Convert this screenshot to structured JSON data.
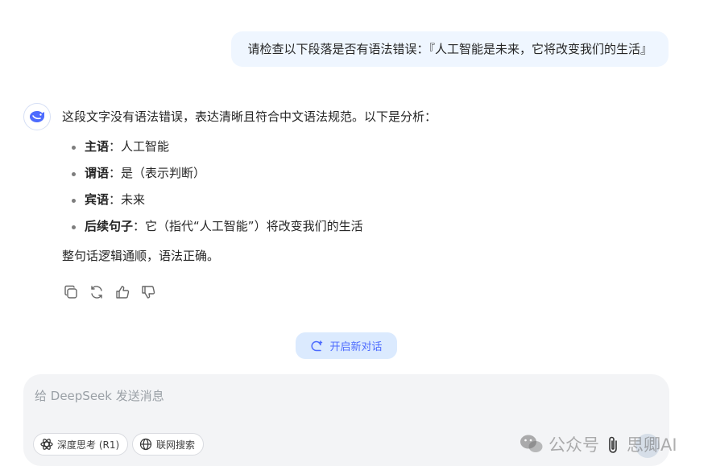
{
  "user_message": "请检查以下段落是否有语法错误：『人工智能是未来，它将改变我们的生活』",
  "assistant": {
    "intro": "这段文字没有语法错误，表达清晰且符合中文语法规范。以下是分析：",
    "items": [
      {
        "label": "主语",
        "sep": "：",
        "text": "人工智能"
      },
      {
        "label": "谓语",
        "sep": "：",
        "text": "是（表示判断）"
      },
      {
        "label": "宾语",
        "sep": "：",
        "text": "未来"
      },
      {
        "label": "后续句子",
        "sep": "：",
        "text": "它（指代“人工智能”）将改变我们的生活"
      }
    ],
    "summary": "整句话逻辑通顺，语法正确。",
    "actions": [
      "copy-icon",
      "regenerate-icon",
      "thumbs-up-icon",
      "thumbs-down-icon"
    ]
  },
  "new_chat": {
    "label": "开启新对话",
    "icon": "new-chat-icon"
  },
  "composer": {
    "placeholder": "给 DeepSeek 发送消息",
    "deep_think_label": "深度思考 (R1)",
    "web_search_label": "联网搜索"
  },
  "watermark": {
    "wechat_label": "公众号",
    "name": "思卿AI"
  },
  "colors": {
    "accent": "#4d6bfe",
    "user_bubble": "#eff6ff",
    "new_chat_bg": "#dbeafe",
    "composer_bg": "#f3f4f6"
  }
}
